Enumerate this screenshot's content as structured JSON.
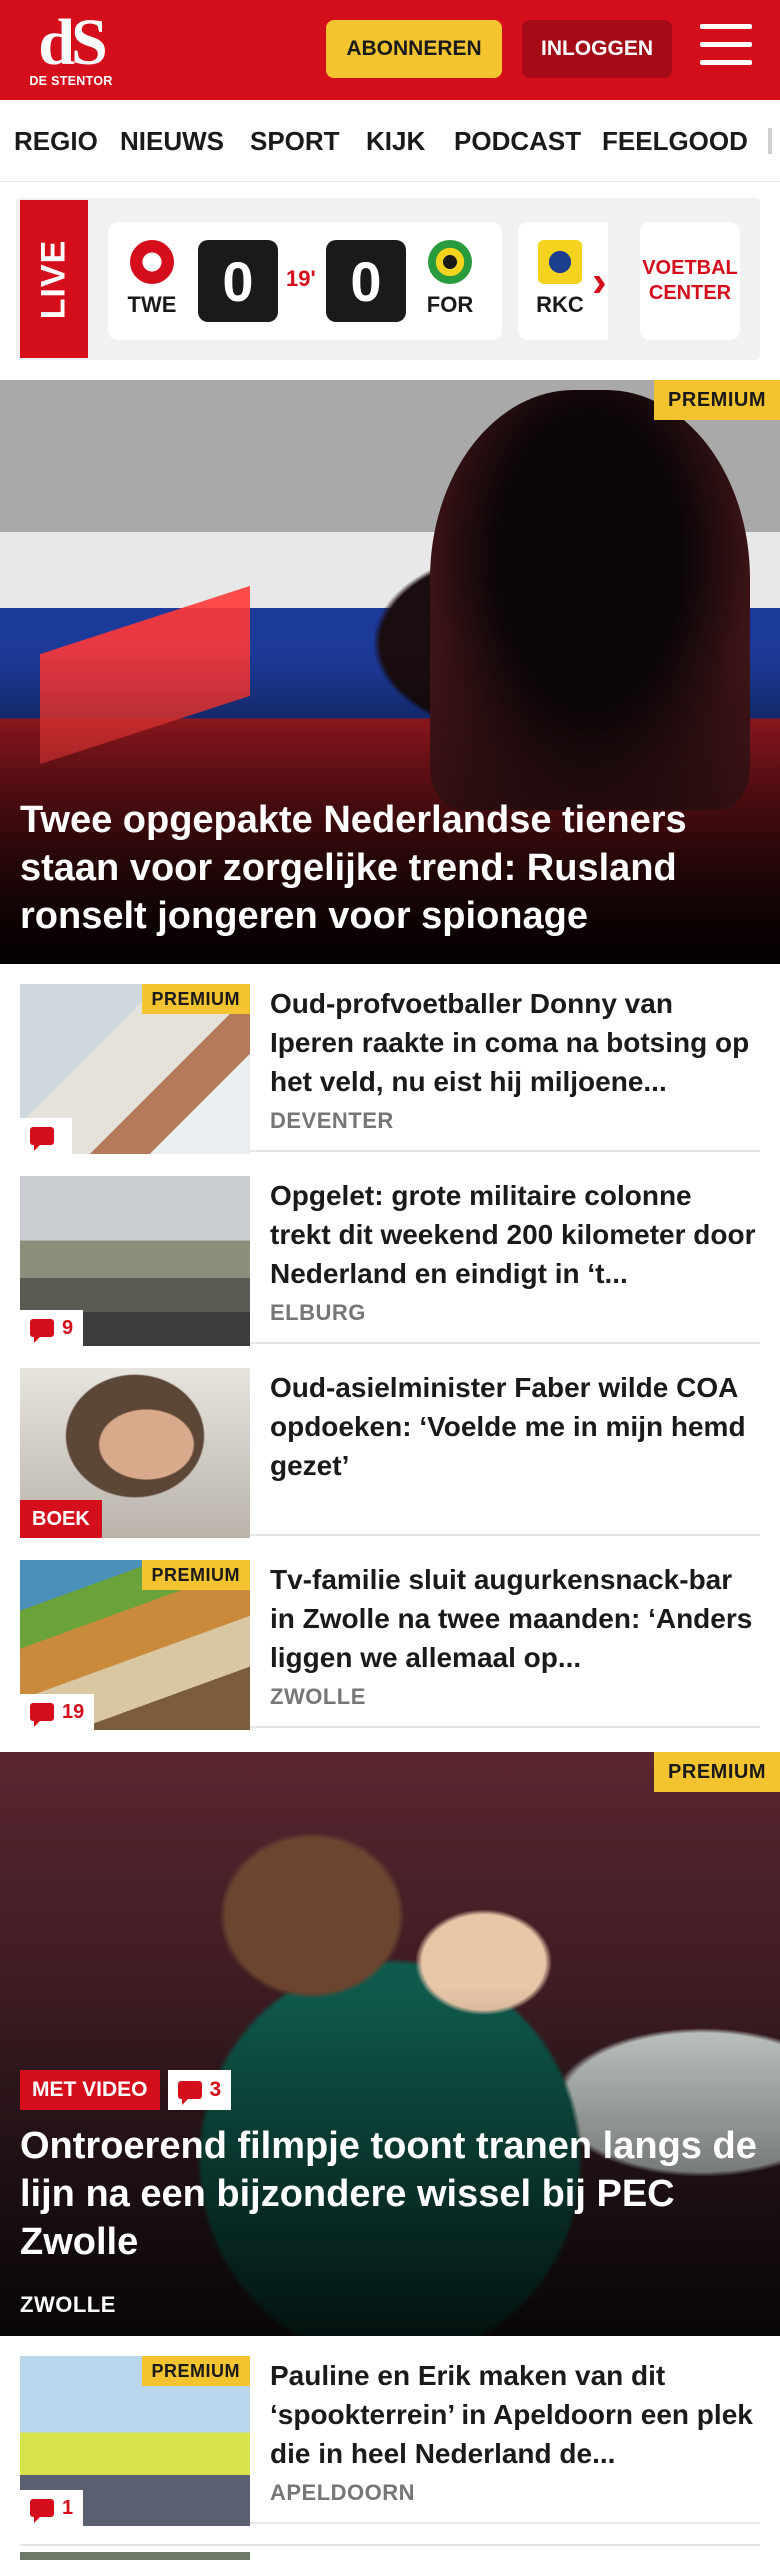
{
  "header": {
    "logo_mark": "dS",
    "logo_sub": "DE STENTOR",
    "subscribe_label": "ABONNEREN",
    "login_label": "INLOGGEN",
    "menu_icon": "hamburger-icon",
    "brand_color": "#d50e1c",
    "accent_color": "#f4c430"
  },
  "nav": {
    "items": [
      "REGIO",
      "NIEUWS",
      "SPORT",
      "KIJK",
      "PODCAST",
      "FEELGOOD"
    ]
  },
  "live": {
    "label": "LIVE",
    "match": {
      "home": "TWE",
      "home_score": "0",
      "minute": "19'",
      "away_score": "0",
      "away": "FOR"
    },
    "next_match_team": "RKC",
    "next_icon": "chevron-right-icon",
    "voetbal_center_line1": "VOETBAL",
    "voetbal_center_line2": "CENTER"
  },
  "hero": {
    "badge": "PREMIUM",
    "title": "Twee opgepakte Nederlandse tieners staan voor zorgelijke trend: Rusland ronselt jongeren voor spionage"
  },
  "articles": [
    {
      "badge": "PREMIUM",
      "comments": "",
      "title": "Oud-profvoetballer Donny van Iperen raakte in coma na botsing op het veld, nu eist hij miljoene...",
      "location": "DEVENTER"
    },
    {
      "badge": "",
      "comments": "9",
      "title": "Opgelet: grote militaire colonne trekt dit weekend 200 kilometer door Nederland en eindigt in ‘t...",
      "location": "ELBURG"
    },
    {
      "label": "BOEK",
      "title": "Oud-asielminister Faber wilde COA opdoeken: ‘Voelde me in mijn hemd gezet’",
      "location": ""
    },
    {
      "badge": "PREMIUM",
      "comments": "19",
      "title": "Tv-familie sluit augurkensnack-bar in Zwolle na twee maanden: ‘Anders liggen we allemaal op...",
      "location": "ZWOLLE"
    }
  ],
  "hero2": {
    "badge": "PREMIUM",
    "video_label": "MET VIDEO",
    "comments": "3",
    "title": "Ontroerend filmpje toont tranen langs de lijn na een bijzondere wissel bij PEC Zwolle",
    "location": "ZWOLLE"
  },
  "article_after": {
    "badge": "PREMIUM",
    "comments": "1",
    "title": "Pauline en Erik maken van dit ‘spookterrein’ in Apeldoorn een plek die in heel Nederland de...",
    "location": "APELDOORN"
  }
}
